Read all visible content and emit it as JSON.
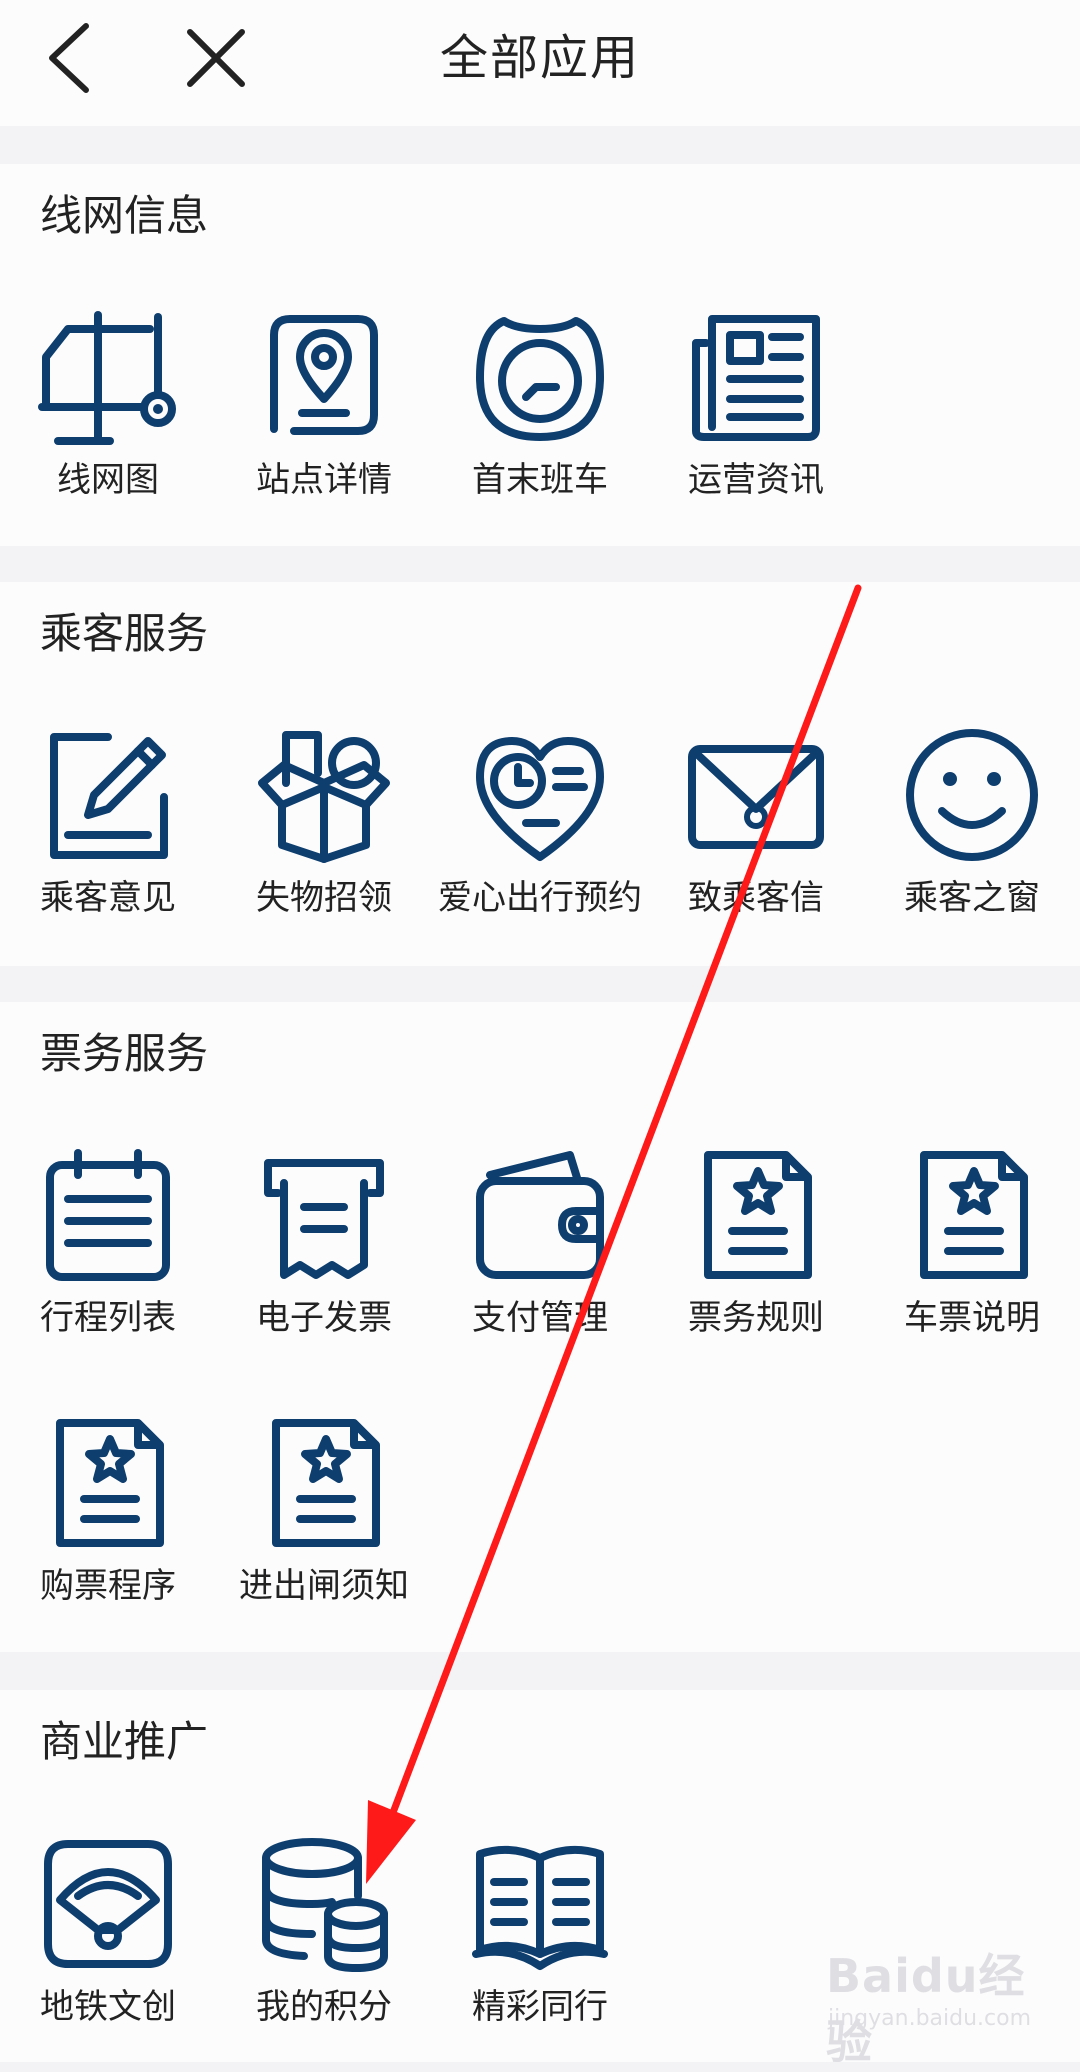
{
  "header": {
    "title": "全部应用",
    "back_icon": "back-chevron-icon",
    "close_icon": "close-icon"
  },
  "sections": [
    {
      "title": "线网信息",
      "items": [
        {
          "label": "线网图",
          "icon": "network-map-icon"
        },
        {
          "label": "站点详情",
          "icon": "location-pin-icon"
        },
        {
          "label": "首末班车",
          "icon": "clock-icon"
        },
        {
          "label": "运营资讯",
          "icon": "newspaper-icon"
        }
      ]
    },
    {
      "title": "乘客服务",
      "items": [
        {
          "label": "乘客意见",
          "icon": "edit-note-icon"
        },
        {
          "label": "失物招领",
          "icon": "lost-box-icon"
        },
        {
          "label": "爱心出行预约",
          "icon": "heart-clock-icon"
        },
        {
          "label": "致乘客信",
          "icon": "envelope-icon"
        },
        {
          "label": "乘客之窗",
          "icon": "smiley-icon"
        }
      ]
    },
    {
      "title": "票务服务",
      "items": [
        {
          "label": "行程列表",
          "icon": "calendar-list-icon"
        },
        {
          "label": "电子发票",
          "icon": "receipt-icon"
        },
        {
          "label": "支付管理",
          "icon": "wallet-icon"
        },
        {
          "label": "票务规则",
          "icon": "star-document-icon"
        },
        {
          "label": "车票说明",
          "icon": "star-document-icon"
        },
        {
          "label": "购票程序",
          "icon": "star-document-icon"
        },
        {
          "label": "进出闸须知",
          "icon": "star-document-icon"
        }
      ]
    },
    {
      "title": "商业推广",
      "items": [
        {
          "label": "地铁文创",
          "icon": "fan-icon"
        },
        {
          "label": "我的积分",
          "icon": "coins-stack-icon"
        },
        {
          "label": "精彩同行",
          "icon": "open-book-icon"
        }
      ]
    }
  ],
  "watermark": {
    "text": "Baidu经验",
    "sub": "jingyan.baidu.com"
  },
  "colors": {
    "icon": "#0d3e6e",
    "annotation_arrow": "#ff1a1a",
    "section_bg": "#fcfcfd",
    "page_bg": "#f3f3f6"
  }
}
